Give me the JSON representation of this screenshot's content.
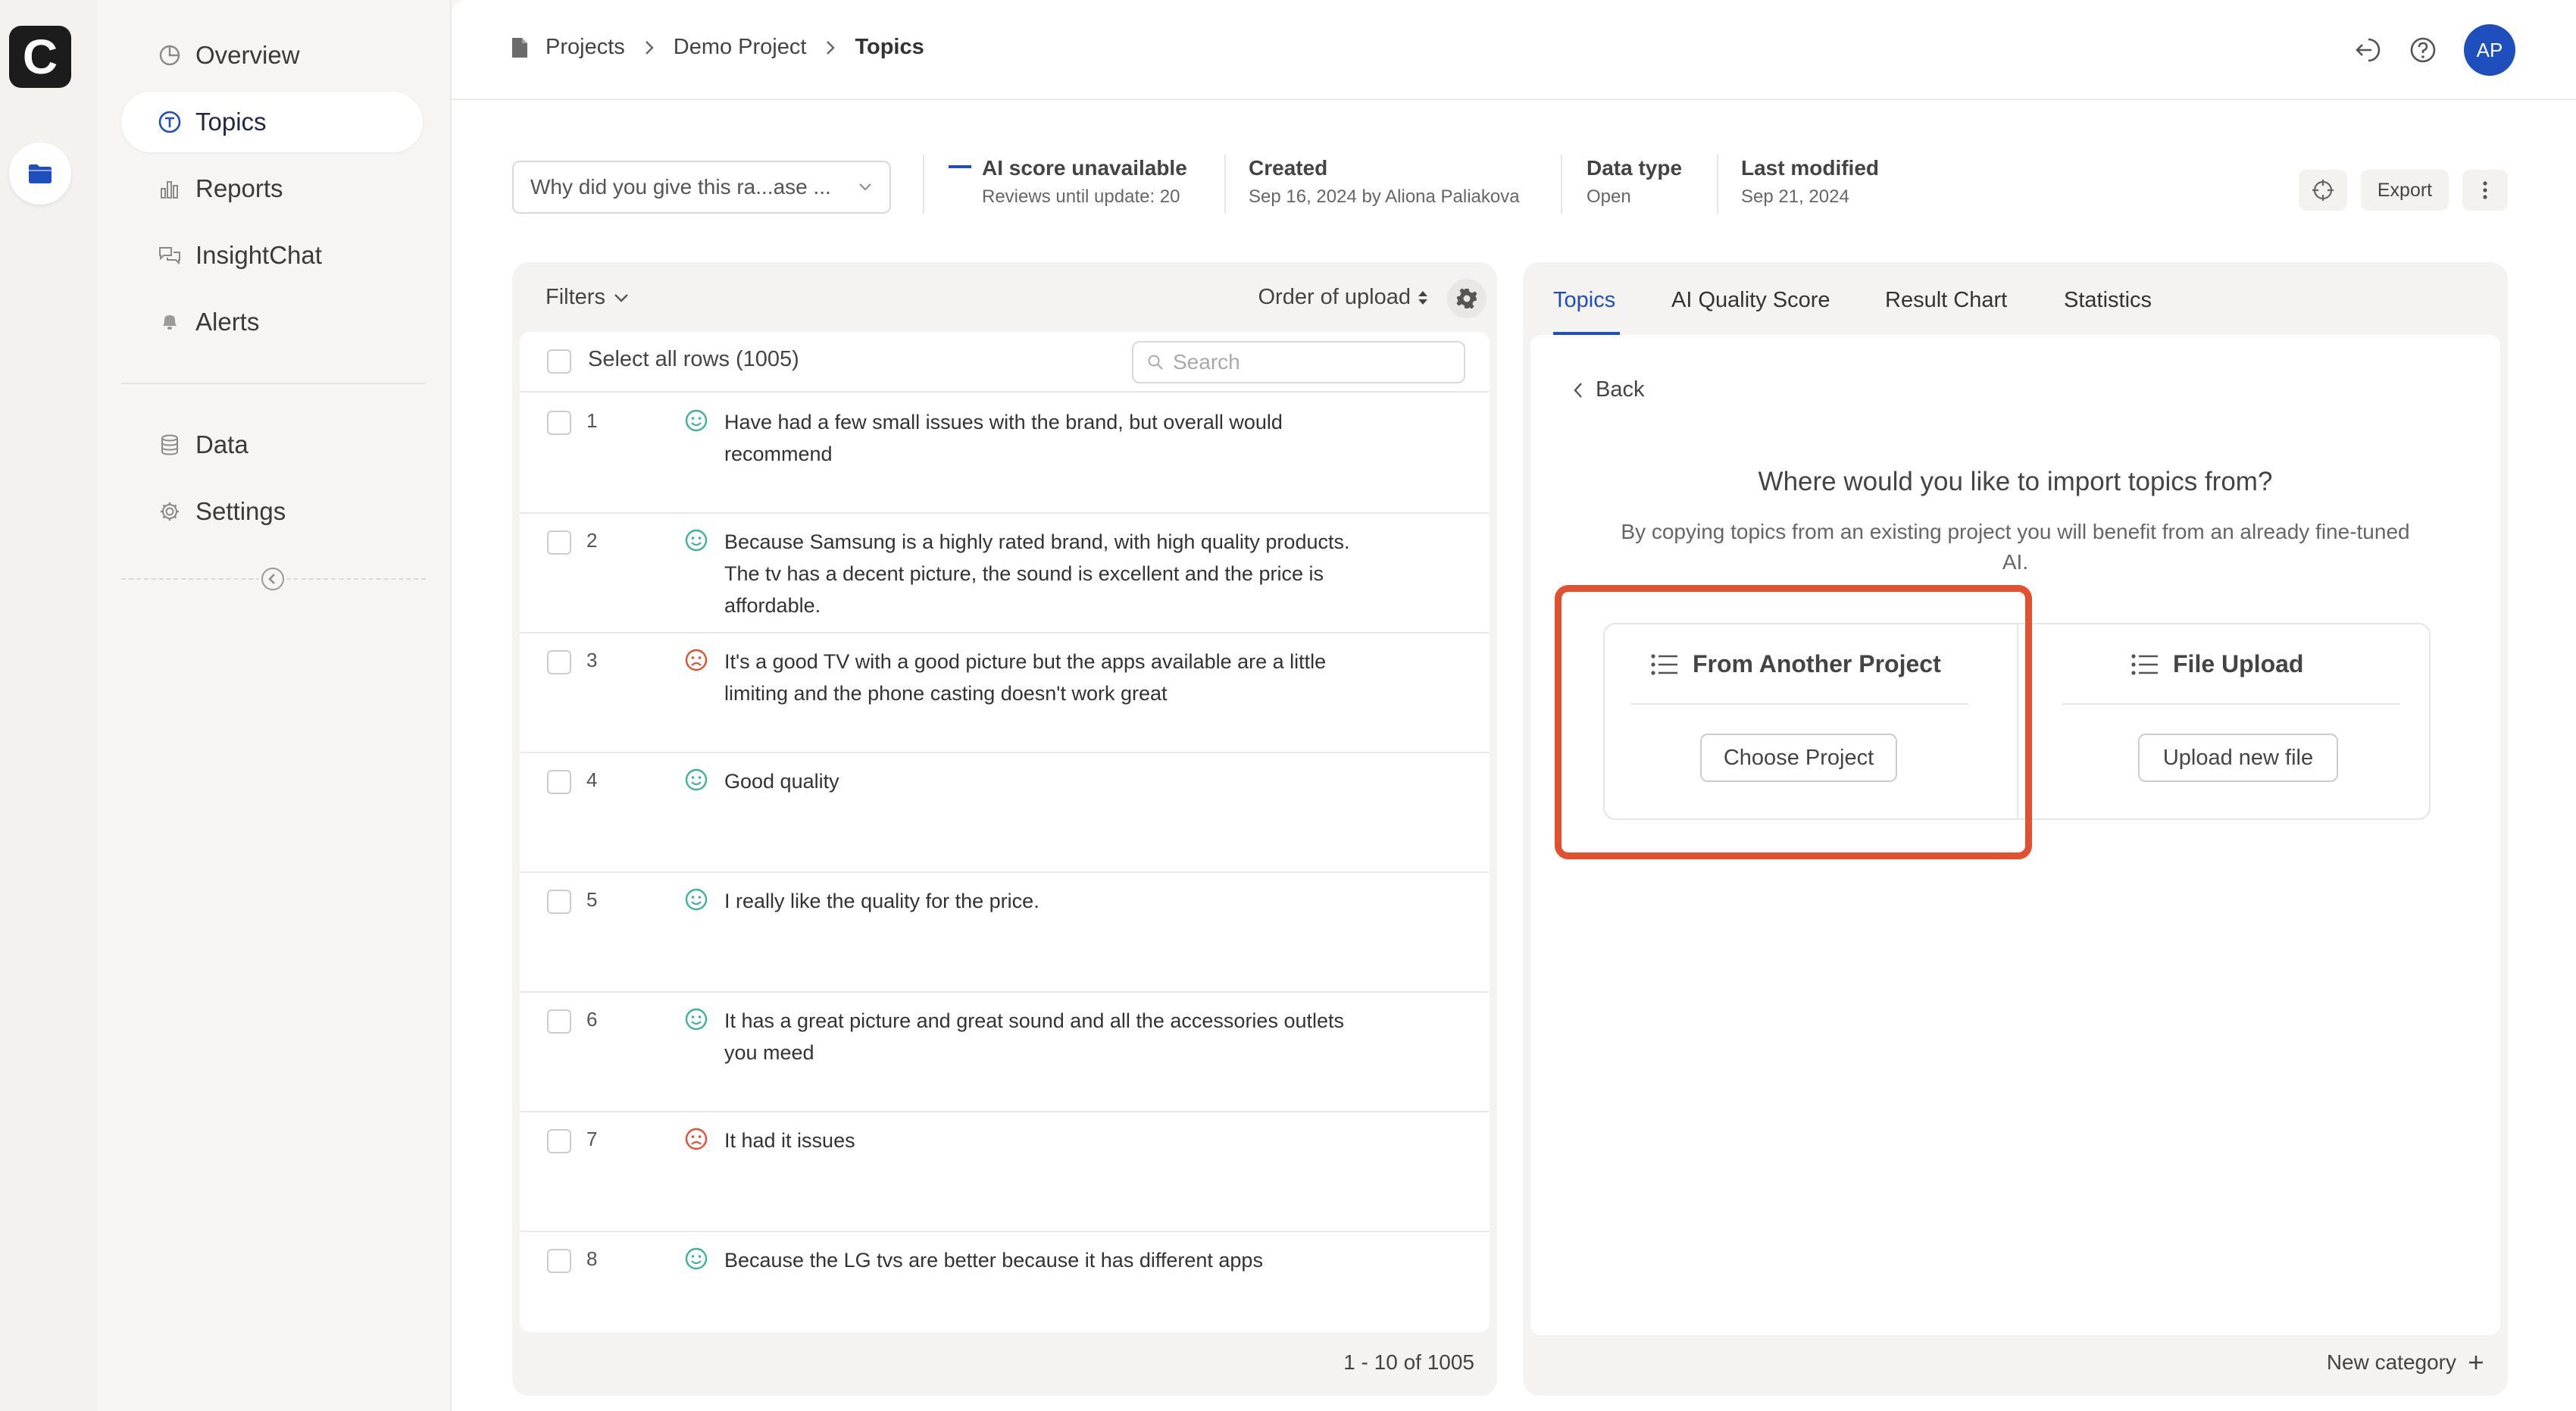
{
  "app": {
    "logo_letter": "C"
  },
  "rail": {
    "projects_icon": "folder-icon"
  },
  "sidebar": {
    "items": [
      {
        "label": "Overview",
        "icon": "pie-chart-icon"
      },
      {
        "label": "Topics",
        "icon": "topic-t-icon",
        "active": true
      },
      {
        "label": "Reports",
        "icon": "bar-chart-icon"
      },
      {
        "label": "InsightChat",
        "icon": "chat-bubbles-icon"
      },
      {
        "label": "Alerts",
        "icon": "bell-icon"
      }
    ],
    "secondary": [
      {
        "label": "Data",
        "icon": "database-icon"
      },
      {
        "label": "Settings",
        "icon": "gear-icon"
      }
    ]
  },
  "breadcrumb": {
    "root": "Projects",
    "project": "Demo Project",
    "current": "Topics"
  },
  "user": {
    "initials": "AP"
  },
  "info_bar": {
    "question": "Why did you give this ra...ase ...",
    "ai_score": {
      "title": "AI score unavailable",
      "sub": "Reviews until update: 20"
    },
    "created": {
      "title": "Created",
      "sub": "Sep 16, 2024 by Aliona Paliakova"
    },
    "data_type": {
      "title": "Data type",
      "sub": "Open"
    },
    "last_modified": {
      "title": "Last modified",
      "sub": "Sep 21, 2024"
    },
    "export_label": "Export"
  },
  "responses": {
    "filters_label": "Filters",
    "order_label": "Order of upload",
    "select_all": "Select all rows (1005)",
    "search_placeholder": "Search",
    "rows": [
      {
        "num": "1",
        "sentiment": "positive",
        "text": "Have had a few small issues with the brand, but overall would recommend"
      },
      {
        "num": "2",
        "sentiment": "positive",
        "text": "Because Samsung is a highly rated brand, with high quality products. The tv has a decent picture, the sound is excellent and the price is affordable."
      },
      {
        "num": "3",
        "sentiment": "negative",
        "text": "It's a good TV with a good picture but the apps available are a little limiting and the phone casting doesn't work great"
      },
      {
        "num": "4",
        "sentiment": "positive",
        "text": "Good quality"
      },
      {
        "num": "5",
        "sentiment": "positive",
        "text": "I really like the quality for the price."
      },
      {
        "num": "6",
        "sentiment": "positive",
        "text": "It has a great picture and great sound and all the accessories outlets you meed"
      },
      {
        "num": "7",
        "sentiment": "negative",
        "text": "It had it issues"
      },
      {
        "num": "8",
        "sentiment": "positive",
        "text": "Because the LG tvs are better because it has different apps"
      }
    ],
    "pagination": "1 - 10 of 1005"
  },
  "topics_panel": {
    "tabs": [
      "Topics",
      "AI Quality Score",
      "Result Chart",
      "Statistics"
    ],
    "active_tab": "Topics",
    "back_label": "Back",
    "import_title": "Where would you like to import topics from?",
    "import_desc": "By copying topics from an existing project you will benefit from an already fine-tuned AI.",
    "options": [
      {
        "title": "From Another Project",
        "button": "Choose Project",
        "highlighted": true
      },
      {
        "title": "File Upload",
        "button": "Upload new file"
      }
    ],
    "new_category": "New category"
  },
  "colors": {
    "accent": "#1f4fbd",
    "highlight": "#e2502f",
    "positive": "#3bb39a",
    "negative": "#e2502f"
  }
}
